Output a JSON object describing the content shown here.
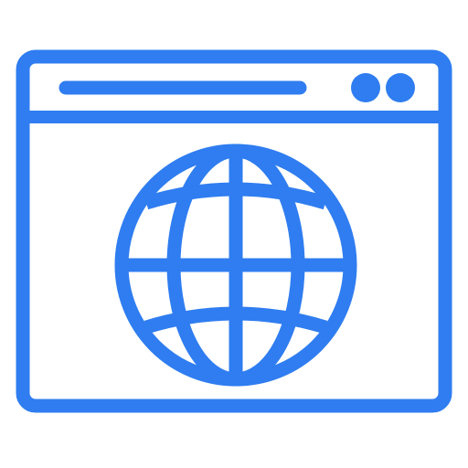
{
  "icon": {
    "name": "browser-window-globe-icon",
    "stroke_color": "#2F7DF0",
    "background_color": "#FFFFFF",
    "parts": {
      "window": "browser-window-icon",
      "address_bar": "address-bar-line",
      "window_controls": [
        "window-control-dot",
        "window-control-dot"
      ],
      "globe": "globe-icon"
    }
  }
}
